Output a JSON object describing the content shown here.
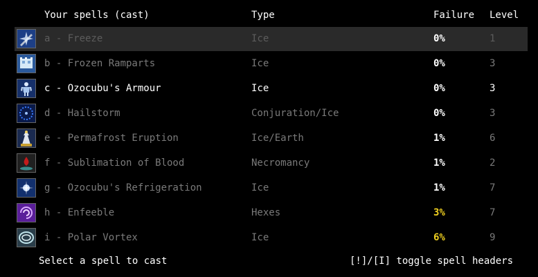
{
  "header": {
    "title": "Your spells (cast)",
    "type": "Type",
    "failure": "Failure",
    "level": "Level"
  },
  "spells": [
    {
      "label": "a - Freeze",
      "type": "Ice",
      "failure": "0%",
      "level": "1",
      "icon": "freeze-icon"
    },
    {
      "label": "b - Frozen Ramparts",
      "type": "Ice",
      "failure": "0%",
      "level": "3",
      "icon": "frozen-ramparts-icon"
    },
    {
      "label": "c - Ozocubu's Armour",
      "type": "Ice",
      "failure": "0%",
      "level": "3",
      "icon": "ozocubus-armour-icon"
    },
    {
      "label": "d - Hailstorm",
      "type": "Conjuration/Ice",
      "failure": "0%",
      "level": "3",
      "icon": "hailstorm-icon"
    },
    {
      "label": "e - Permafrost Eruption",
      "type": "Ice/Earth",
      "failure": "1%",
      "level": "6",
      "icon": "permafrost-eruption-icon"
    },
    {
      "label": "f - Sublimation of Blood",
      "type": "Necromancy",
      "failure": "1%",
      "level": "2",
      "icon": "sublimation-of-blood-icon"
    },
    {
      "label": "g - Ozocubu's Refrigeration",
      "type": "Ice",
      "failure": "1%",
      "level": "7",
      "icon": "ozocubus-refrigeration-icon"
    },
    {
      "label": "h - Enfeeble",
      "type": "Hexes",
      "failure": "3%",
      "level": "7",
      "icon": "enfeeble-icon"
    },
    {
      "label": "i - Polar Vortex",
      "type": "Ice",
      "failure": "6%",
      "level": "9",
      "icon": "polar-vortex-icon"
    }
  ],
  "footer": {
    "prompt": "Select a spell to cast",
    "toggle": "[!]/[I] toggle spell headers"
  },
  "colors": {
    "failure_low": "#ffffff",
    "failure_mid": "#f0d020",
    "text_dim": "#7a7a7a",
    "text_highlight": "#ffffff",
    "selected_row": "#2a2a2a"
  }
}
